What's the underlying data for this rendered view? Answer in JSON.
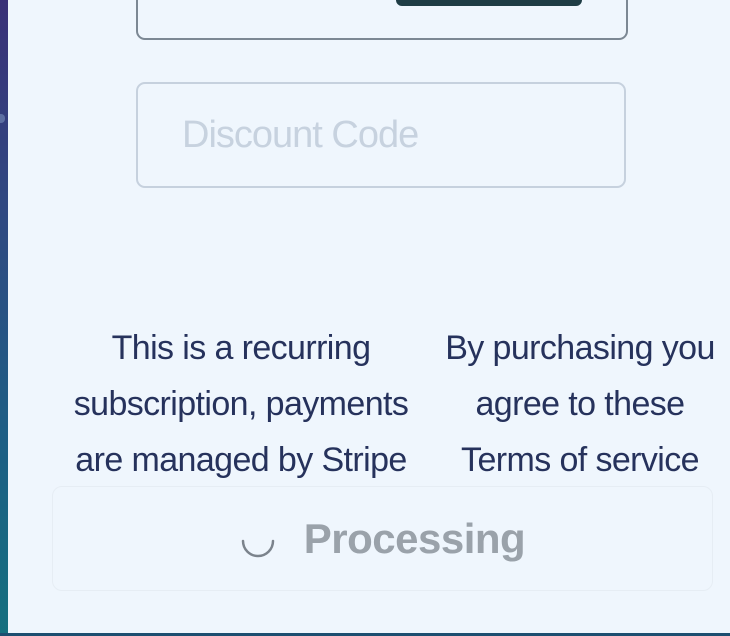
{
  "discount": {
    "placeholder": "Discount Code",
    "value": ""
  },
  "notices": {
    "recurring_lines": [
      "This is a recurring",
      "subscription, payments",
      "are managed by Stripe"
    ],
    "terms_lines": [
      "By purchasing you",
      "agree to these",
      "Terms of service"
    ]
  },
  "submit": {
    "label": "Processing",
    "icon": "spinner-icon",
    "state": "processing"
  },
  "colors": {
    "panel_background": "#eff6fd",
    "text": "#26325c",
    "placeholder": "#c7d2df",
    "disabled_text": "#9aa2aa",
    "previous_button": "#1f3d45"
  }
}
